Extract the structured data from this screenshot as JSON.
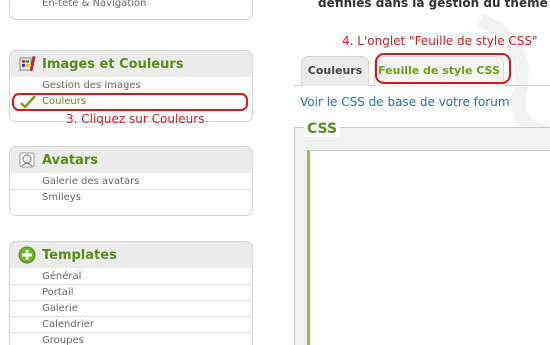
{
  "colors": {
    "accent_green": "#5a8a1a",
    "annotation_red": "#cc2020",
    "link_blue": "#2a6fa8"
  },
  "sidebar": {
    "top_partial_item": "En-tête & Navigation",
    "images_panel": {
      "title": "Images et Couleurs",
      "icon": "palette-brush-icon",
      "items": [
        "Gestion des images",
        "Couleurs"
      ]
    },
    "avatars_panel": {
      "title": "Avatars",
      "icon": "avatar-face-icon",
      "items": [
        "Galerie des avatars",
        "Smileys"
      ]
    },
    "templates_panel": {
      "title": "Templates",
      "icon": "plus-circle-icon",
      "items": [
        "Général",
        "Portail",
        "Galerie",
        "Calendrier",
        "Groupes"
      ]
    }
  },
  "annotations": {
    "step3": "3. Cliquez sur Couleurs",
    "step4": "4. L'onglet \"Feuille de style CSS\""
  },
  "main": {
    "top_text": "définies dans la gestion du thème (le",
    "tabs": [
      {
        "label": "Couleurs"
      },
      {
        "label": "Feuille de style CSS"
      }
    ],
    "base_css_link": "Voir le CSS de base de votre forum",
    "css_section_title": "CSS"
  }
}
